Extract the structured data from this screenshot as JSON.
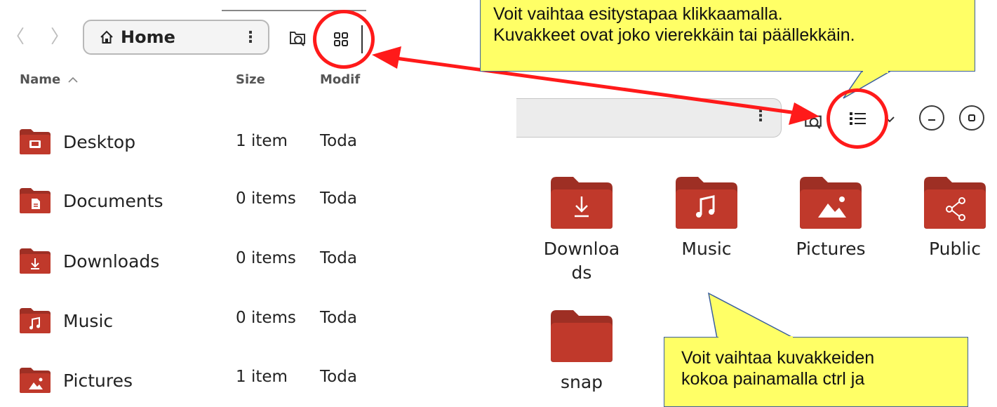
{
  "left_panel": {
    "nav": {
      "back_label": "〈",
      "forward_label": "〉"
    },
    "location": {
      "title": "Home",
      "menu_label": "⋮"
    },
    "columns": {
      "name": "Name",
      "size": "Size",
      "modified": "Modif"
    },
    "rows": [
      {
        "name": "Desktop",
        "size": "1 item",
        "modified": "Toda",
        "icon": "desktop-folder-icon"
      },
      {
        "name": "Documents",
        "size": "0 items",
        "modified": "Toda",
        "icon": "documents-folder-icon"
      },
      {
        "name": "Downloads",
        "size": "0 items",
        "modified": "Toda",
        "icon": "downloads-folder-icon"
      },
      {
        "name": "Music",
        "size": "0 items",
        "modified": "Toda",
        "icon": "music-folder-icon"
      },
      {
        "name": "Pictures",
        "size": "1 item",
        "modified": "Toda",
        "icon": "pictures-folder-icon"
      }
    ]
  },
  "right_panel": {
    "location": {
      "menu_label": "⋮"
    },
    "items": [
      {
        "label": "Downloa\nds",
        "icon": "downloads-folder-icon"
      },
      {
        "label": "Music",
        "icon": "music-folder-icon"
      },
      {
        "label": "Pictures",
        "icon": "pictures-folder-icon"
      },
      {
        "label": "Public",
        "icon": "public-folder-icon"
      },
      {
        "label": "snap",
        "icon": "folder-icon"
      }
    ]
  },
  "annotations": {
    "top_callout_line1": "Voit vaihtaa esitystapaa klikkaamalla.",
    "top_callout_line2": "Kuvakkeet ovat joko vierekkäin tai päällekkäin.",
    "bottom_callout_line1": "Voit vaihtaa kuvakkeiden",
    "bottom_callout_line2": "kokoa painamalla  ctrl ja"
  },
  "colors": {
    "folder": "#c0392b",
    "folder_tab": "#9e2f24",
    "annotation_red": "#ff1a1a",
    "callout_yellow": "#ffff66"
  }
}
